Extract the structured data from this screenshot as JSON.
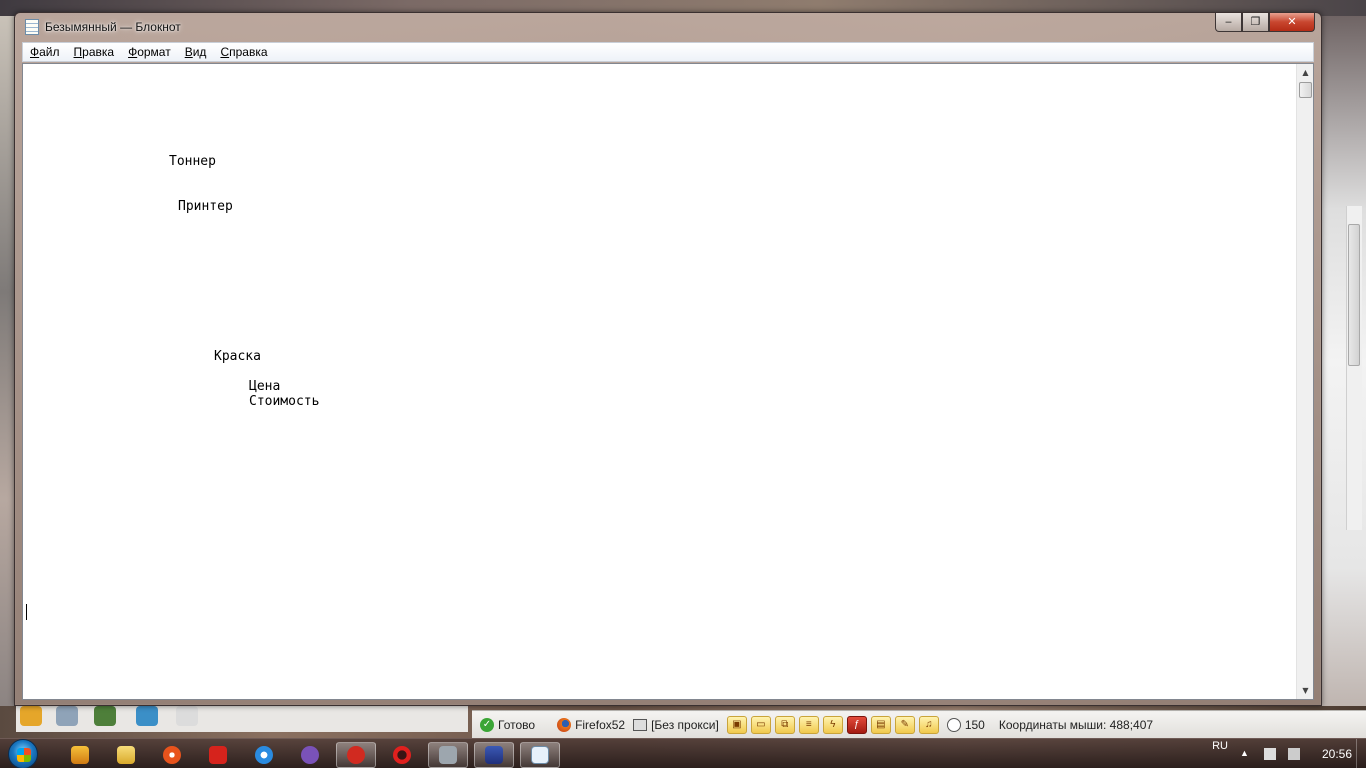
{
  "window": {
    "title": "Безымянный — Блокнот",
    "minimize_symbol": "‒",
    "maximize_symbol": "❐",
    "close_symbol": "✕"
  },
  "menu": {
    "file": "Файл",
    "edit": "Правка",
    "format": "Формат",
    "view": "Вид",
    "help": "Справка"
  },
  "document": {
    "lines": [
      "Тоннер",
      "Принтер",
      "Краска",
      "Цена",
      "Стоимость"
    ]
  },
  "browser_status": {
    "ready": "Готово",
    "browser_name": "Firefox52",
    "proxy": "[Без прокси]",
    "counter": "150",
    "mouse_coords": "Координаты мыши: 488;407"
  },
  "tray": {
    "language": "RU",
    "time": "20:56"
  },
  "icons": {
    "notepad": "notepad-icon",
    "start": "windows-start-icon",
    "firefox": "firefox-icon"
  },
  "colors": {
    "close_red": "#c8462f",
    "accent_blue": "#1a78c2",
    "ready_green": "#3aa535"
  }
}
